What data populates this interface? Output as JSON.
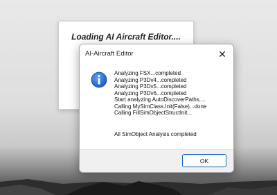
{
  "splash": {
    "title": "Loading AI Aircraft Editor...."
  },
  "dialog": {
    "title": "AI-Aircraft Editor",
    "close_glyph": "✕",
    "icon": "info-icon",
    "icon_color": "#1e5fbf",
    "messages": [
      "Analyzing FSX...completed",
      "Analyzing P3Dv4...completed",
      "Analyzing P3Dv5...completed",
      "Analyzing P3Dv6...completed",
      "Start analyzing AutoDiscoverPaths....",
      "Calling MySimClass.Init(False)...done",
      "Calling FillSimObjectStructInit..."
    ],
    "summary": "All SimObject Analysis completed",
    "ok_label": "OK"
  },
  "colors": {
    "accent": "#0067c0",
    "footer_bg": "#f0f0f0"
  }
}
